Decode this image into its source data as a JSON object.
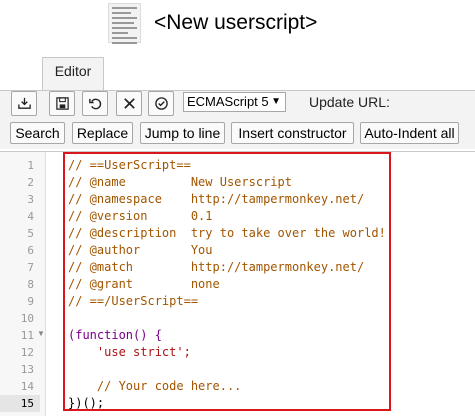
{
  "header": {
    "title": "<New userscript>"
  },
  "tabs": [
    {
      "label": "Editor"
    }
  ],
  "toolbar": {
    "icons": [
      "save-to-disk-icon",
      "save-icon",
      "undo-icon",
      "close-icon",
      "check-circle-icon"
    ],
    "language": "ECMAScript 5",
    "update_url_label": "Update URL:",
    "buttons": [
      "Search",
      "Replace",
      "Jump to line",
      "Insert constructor",
      "Auto-Indent all"
    ]
  },
  "editor": {
    "line_numbers": [
      "1",
      "2",
      "3",
      "4",
      "5",
      "6",
      "7",
      "8",
      "9",
      "10",
      "11",
      "12",
      "13",
      "14",
      "15"
    ],
    "active_line": "15",
    "lines": [
      "// ==UserScript==",
      "// @name         New Userscript",
      "// @namespace    http://tampermonkey.net/",
      "// @version      0.1",
      "// @description  try to take over the world!",
      "// @author       You",
      "// @match        http://tampermonkey.net/",
      "// @grant        none",
      "// ==/UserScript==",
      "",
      "(function() {",
      "    'use strict';",
      "",
      "    // Your code here...",
      "})();"
    ]
  },
  "colors": {
    "comment": "#a25500",
    "string": "#aa1111",
    "keyword": "#770088",
    "highlight_box": "#d9161c"
  }
}
